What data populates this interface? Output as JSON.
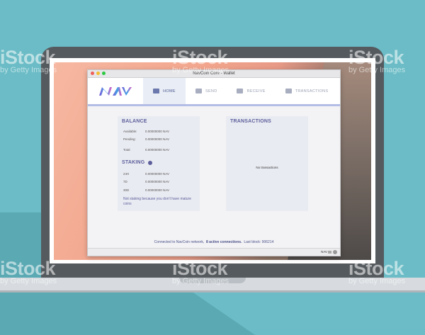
{
  "window": {
    "title": "NavCoin Core - Wallet"
  },
  "logo": {
    "text": "NAV"
  },
  "nav": {
    "home": "HOME",
    "send": "SEND",
    "receive": "RECEIVE",
    "transactions": "TRANSACTIONS"
  },
  "balance": {
    "title": "BALANCE",
    "rows": [
      {
        "label": "Available:",
        "value": "0.00000000 NAV"
      },
      {
        "label": "Pending:",
        "value": "0.00000000 NAV"
      },
      {
        "label": "Total",
        "value": "0.00000000 NAV"
      }
    ]
  },
  "staking": {
    "title": "STAKING",
    "rows": [
      {
        "label": "24H",
        "value": "0.00000000 NAV"
      },
      {
        "label": "7D",
        "value": "0.00000000 NAV"
      },
      {
        "label": "30D",
        "value": "0.00000000 NAV"
      }
    ],
    "message": "Not staking because you don't have mature coins"
  },
  "transactions": {
    "title": "TRANSACTIONS",
    "empty": "No transactions"
  },
  "status": {
    "prefix": "Connected to NavCoin network,",
    "connections": "8 active connections.",
    "block": "Last block: 906214"
  },
  "statusbar": {
    "unit": "NAV"
  },
  "watermark": {
    "brand": "iStock",
    "sub": "by Getty Images"
  },
  "colors": {
    "accent": "#5c5e9b",
    "nav_underline": "#b3bde6",
    "background": "#6bbcc6"
  }
}
